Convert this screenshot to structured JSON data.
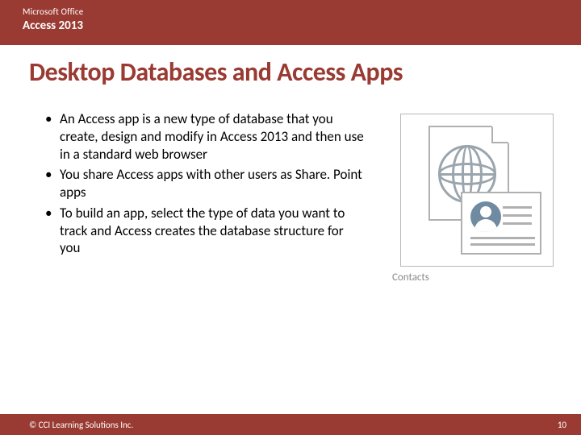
{
  "header": {
    "brand": "Microsoft Office",
    "product": "Access 2013"
  },
  "title": "Desktop Databases and Access Apps",
  "bullets": [
    "An Access app is a new type of database that you create, design and modify in Access 2013 and then use in a standard web browser",
    "You share Access apps with other users as Share. Point apps",
    "To build an app, select the type of data you want to track and Access creates the database structure for you"
  ],
  "figure": {
    "caption": "Contacts"
  },
  "footer": {
    "copyright": "© CCI Learning Solutions Inc.",
    "page": "10"
  }
}
